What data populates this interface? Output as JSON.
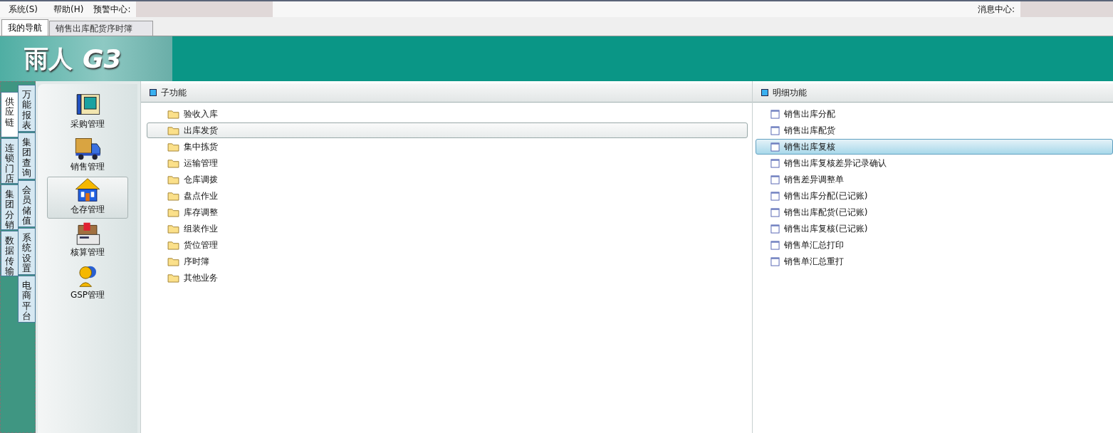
{
  "menu_bar": {
    "items": [
      "系统(S)",
      "帮助(H)"
    ],
    "alert_label": "预警中心:",
    "message_label": "消息中心:"
  },
  "tabs": [
    {
      "label": "我的导航",
      "selected": true
    },
    {
      "label": "销售出库配货序时簿",
      "selected": false
    }
  ],
  "banner": {
    "logo_text": "雨人",
    "logo_version": "G3"
  },
  "side_tabs": [
    {
      "label": "供应链",
      "selected": true
    },
    {
      "label": "连锁门店",
      "selected": false
    },
    {
      "label": "集团分销",
      "selected": false
    },
    {
      "label": "数据传输",
      "selected": false
    }
  ],
  "module_tabs": [
    {
      "label": "万能报表",
      "selected": false
    },
    {
      "label": "集团查询",
      "selected": false
    },
    {
      "label": "会员储值",
      "selected": false
    },
    {
      "label": "系统设置",
      "selected": false
    },
    {
      "label": "电商平台",
      "selected": false
    }
  ],
  "nav_items": [
    {
      "label": "采购管理",
      "kind": "phone",
      "selected": false
    },
    {
      "label": "销售管理",
      "kind": "truck",
      "selected": false
    },
    {
      "label": "仓存管理",
      "kind": "house",
      "selected": true
    },
    {
      "label": "核算管理",
      "kind": "calculator",
      "selected": false
    },
    {
      "label": "GSP管理",
      "kind": "person",
      "selected": false
    }
  ],
  "sub_functions": {
    "title": "子功能",
    "items": [
      {
        "label": "验收入库",
        "selected": false
      },
      {
        "label": "出库发货",
        "selected": true
      },
      {
        "label": "集中拣货",
        "selected": false
      },
      {
        "label": "运输管理",
        "selected": false
      },
      {
        "label": "仓库调拨",
        "selected": false
      },
      {
        "label": "盘点作业",
        "selected": false
      },
      {
        "label": "库存调整",
        "selected": false
      },
      {
        "label": "组装作业",
        "selected": false
      },
      {
        "label": "货位管理",
        "selected": false
      },
      {
        "label": "序时簿",
        "selected": false
      },
      {
        "label": "其他业务",
        "selected": false
      }
    ]
  },
  "detail_functions": {
    "title": "明细功能",
    "items": [
      {
        "label": "销售出库分配",
        "selected": false
      },
      {
        "label": "销售出库配货",
        "selected": false
      },
      {
        "label": "销售出库复核",
        "selected": true
      },
      {
        "label": "销售出库复核差异记录确认",
        "selected": false
      },
      {
        "label": "销售差异调整单",
        "selected": false
      },
      {
        "label": "销售出库分配(已记账)",
        "selected": false
      },
      {
        "label": "销售出库配货(已记账)",
        "selected": false
      },
      {
        "label": "销售出库复核(已记账)",
        "selected": false
      },
      {
        "label": "销售单汇总打印",
        "selected": false
      },
      {
        "label": "销售单汇总重打",
        "selected": false
      }
    ]
  }
}
